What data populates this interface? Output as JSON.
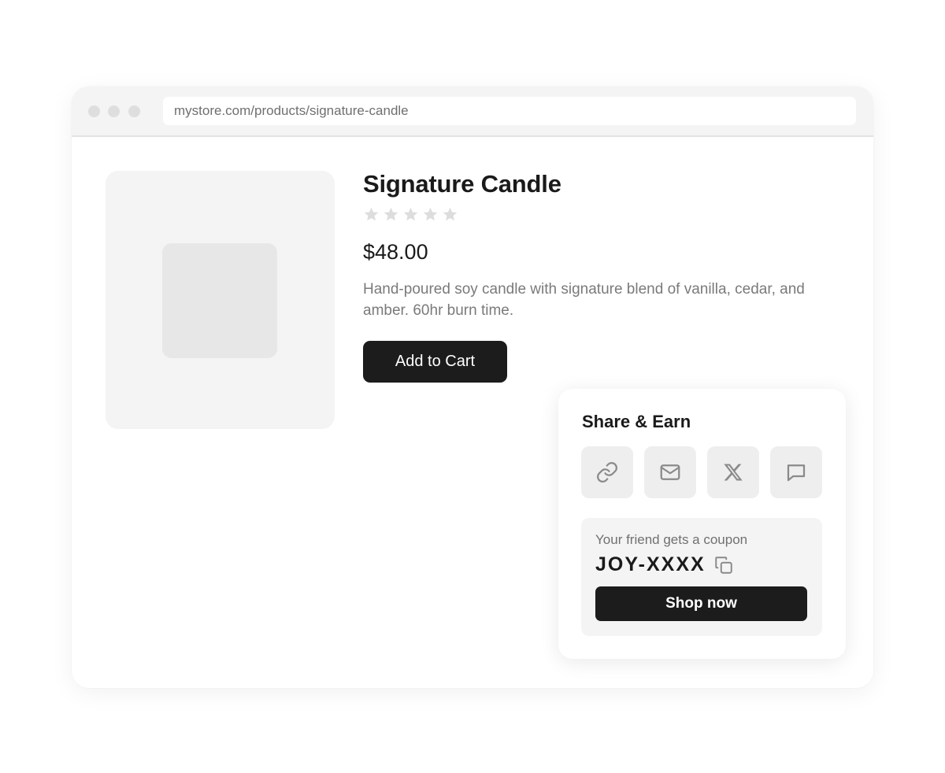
{
  "browser": {
    "url": "mystore.com/products/signature-candle"
  },
  "product": {
    "title": "Signature Candle",
    "rating": 0,
    "rating_max": 5,
    "price": "$48.00",
    "description": "Hand-poured soy candle with signature blend of vanilla, cedar, and amber. 60hr burn time.",
    "add_to_cart_label": "Add to Cart",
    "image_icon": "image-placeholder-icon"
  },
  "share_card": {
    "title": "Share & Earn",
    "buttons": [
      {
        "icon": "link-icon"
      },
      {
        "icon": "mail-icon"
      },
      {
        "icon": "x-logo-icon"
      },
      {
        "icon": "chat-bubble-icon"
      }
    ],
    "coupon": {
      "label": "Your friend gets a coupon",
      "code": "JOY-XXXX",
      "copy_icon": "copy-icon",
      "cta_label": "Shop now"
    }
  },
  "colors": {
    "primary_button": "#1c1c1c",
    "star_empty": "#dddddd",
    "muted_text": "#7a7a7a",
    "panel_bg": "#f4f4f4"
  }
}
